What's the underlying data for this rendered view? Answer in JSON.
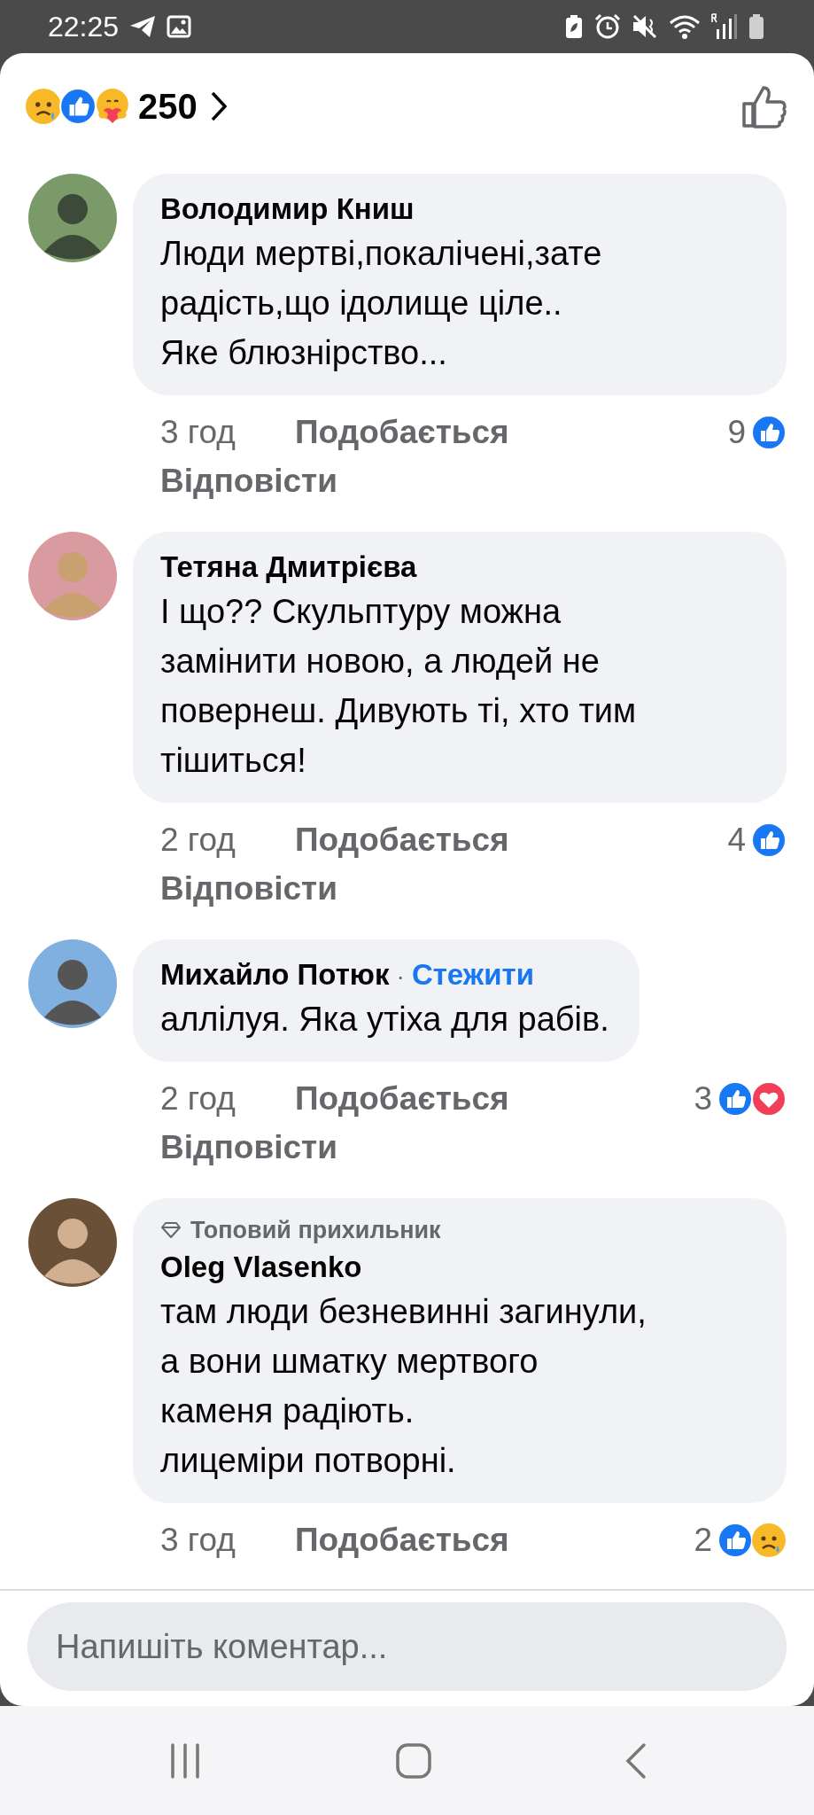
{
  "status_bar": {
    "time": "22:25"
  },
  "reactions_summary": {
    "reactions": [
      {
        "kind": "sad"
      },
      {
        "kind": "like"
      },
      {
        "kind": "care"
      }
    ],
    "count": "250"
  },
  "comments": [
    {
      "author": "Володимир Книш",
      "lines": [
        "Люди мертві,покалічені,зате",
        "радість,що ідолище ціле..",
        "Яке блюзнірство..."
      ],
      "time": "3 год",
      "like_label": "Подобається",
      "reply_label": "Відповісти",
      "reaction_count": "9",
      "reactions": [
        {
          "kind": "like"
        }
      ]
    },
    {
      "author": "Тетяна Дмитрієва",
      "lines": [
        "І що?? Скульптуру можна",
        "замінити новою, а людей не",
        "повернеш. Дивують ті, хто тим",
        "тішиться!"
      ],
      "time": "2 год",
      "like_label": "Подобається",
      "reply_label": "Відповісти",
      "reaction_count": "4",
      "reactions": [
        {
          "kind": "like"
        }
      ]
    },
    {
      "author": "Михайло Потюк",
      "separator": "·",
      "follow": "Стежити",
      "lines": [
        "аллілуя. Яка утіха для рабів."
      ],
      "time": "2 год",
      "like_label": "Подобається",
      "reply_label": "Відповісти",
      "reaction_count": "3",
      "reactions": [
        {
          "kind": "like"
        },
        {
          "kind": "love"
        }
      ]
    },
    {
      "author": "Oleg Vlasenko",
      "badge": "Топовий прихильник",
      "lines": [
        "там люди безневинні загинули,",
        "а вони шматку мертвого",
        "каменя радіють.",
        "лицеміри потворні."
      ],
      "time": "3 год",
      "like_label": "Подобається",
      "reaction_count": "2",
      "reactions": [
        {
          "kind": "like"
        },
        {
          "kind": "sad"
        }
      ]
    }
  ],
  "comment_field": {
    "placeholder": "Напишіть коментар..."
  }
}
